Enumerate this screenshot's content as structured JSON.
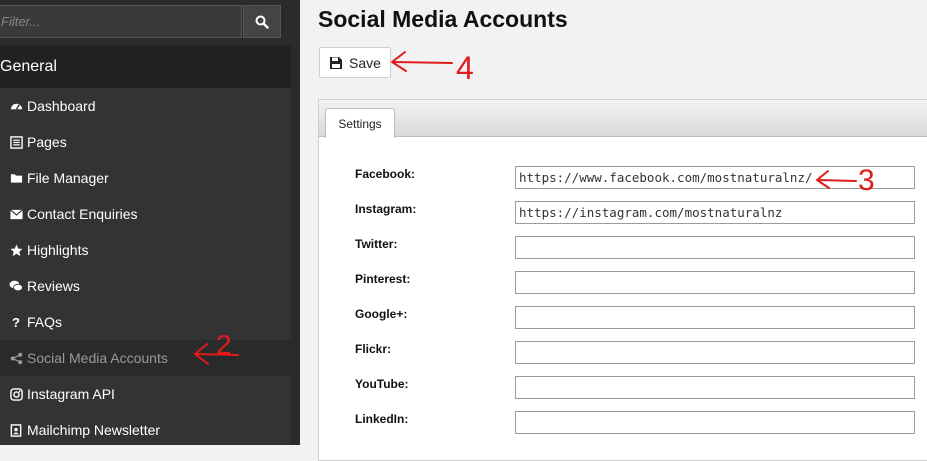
{
  "sidebar": {
    "filter_placeholder": "Filter...",
    "section_title": "General",
    "items": [
      {
        "label": "Dashboard",
        "icon": "dashboard-icon"
      },
      {
        "label": "Pages",
        "icon": "list-icon"
      },
      {
        "label": "File Manager",
        "icon": "folder-icon"
      },
      {
        "label": "Contact Enquiries",
        "icon": "envelope-icon"
      },
      {
        "label": "Highlights",
        "icon": "star-icon"
      },
      {
        "label": "Reviews",
        "icon": "comments-icon"
      },
      {
        "label": "FAQs",
        "icon": "question-icon"
      },
      {
        "label": "Social Media Accounts",
        "icon": "share-icon",
        "active": true
      },
      {
        "label": "Instagram API",
        "icon": "instagram-icon"
      },
      {
        "label": "Mailchimp Newsletter",
        "icon": "newsletter-icon"
      }
    ]
  },
  "main": {
    "title": "Social Media Accounts",
    "save_label": "Save",
    "tab_label": "Settings",
    "fields": [
      {
        "label": "Facebook:",
        "value": "https://www.facebook.com/mostnaturalnz/"
      },
      {
        "label": "Instagram:",
        "value": "https://instagram.com/mostnaturalnz"
      },
      {
        "label": "Twitter:",
        "value": ""
      },
      {
        "label": "Pinterest:",
        "value": ""
      },
      {
        "label": "Google+:",
        "value": ""
      },
      {
        "label": "Flickr:",
        "value": ""
      },
      {
        "label": "YouTube:",
        "value": ""
      },
      {
        "label": "LinkedIn:",
        "value": ""
      }
    ]
  },
  "annotations": {
    "save_number": "4",
    "facebook_number": "3",
    "sidebar_number": "2",
    "color": "#e01b1b"
  }
}
